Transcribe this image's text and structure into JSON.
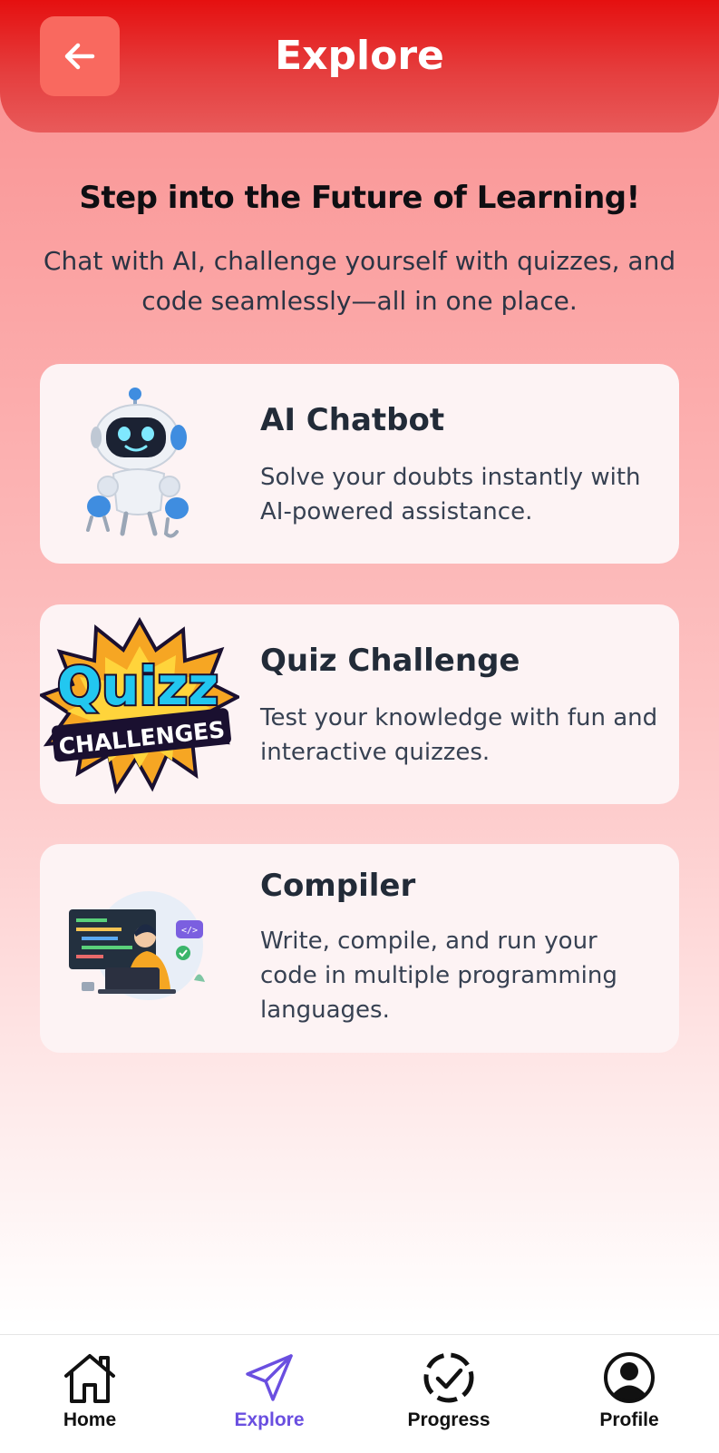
{
  "header": {
    "title": "Explore",
    "back_icon": "arrow-left-icon"
  },
  "hero": {
    "headline": "Step into the Future of Learning!",
    "subtitle": "Chat with AI, challenge yourself with quizzes, and code seamlessly—all in one place."
  },
  "cards": [
    {
      "title": "AI Chatbot",
      "description": "Solve your doubts instantly with AI-powered assistance.",
      "image": "robot-illustration"
    },
    {
      "title": "Quiz Challenge",
      "description": "Test your knowledge with fun and interactive quizzes.",
      "image": "quizz-challenges-badge",
      "image_text_1": "Quizz",
      "image_text_2": "CHALLENGES"
    },
    {
      "title": "Compiler",
      "description": "Write, compile, and run your code in multiple programming languages.",
      "image": "coder-illustration",
      "image_text": "</>"
    }
  ],
  "nav": {
    "items": [
      {
        "label": "Home",
        "icon": "home-icon",
        "active": false
      },
      {
        "label": "Explore",
        "icon": "send-icon",
        "active": true
      },
      {
        "label": "Progress",
        "icon": "progress-check-icon",
        "active": false
      },
      {
        "label": "Profile",
        "icon": "profile-icon",
        "active": false
      }
    ],
    "active_color": "#6a4fe0"
  },
  "colors": {
    "header": "#e51010",
    "back_button": "#f9695f",
    "card_bg": "#fdf3f4"
  }
}
